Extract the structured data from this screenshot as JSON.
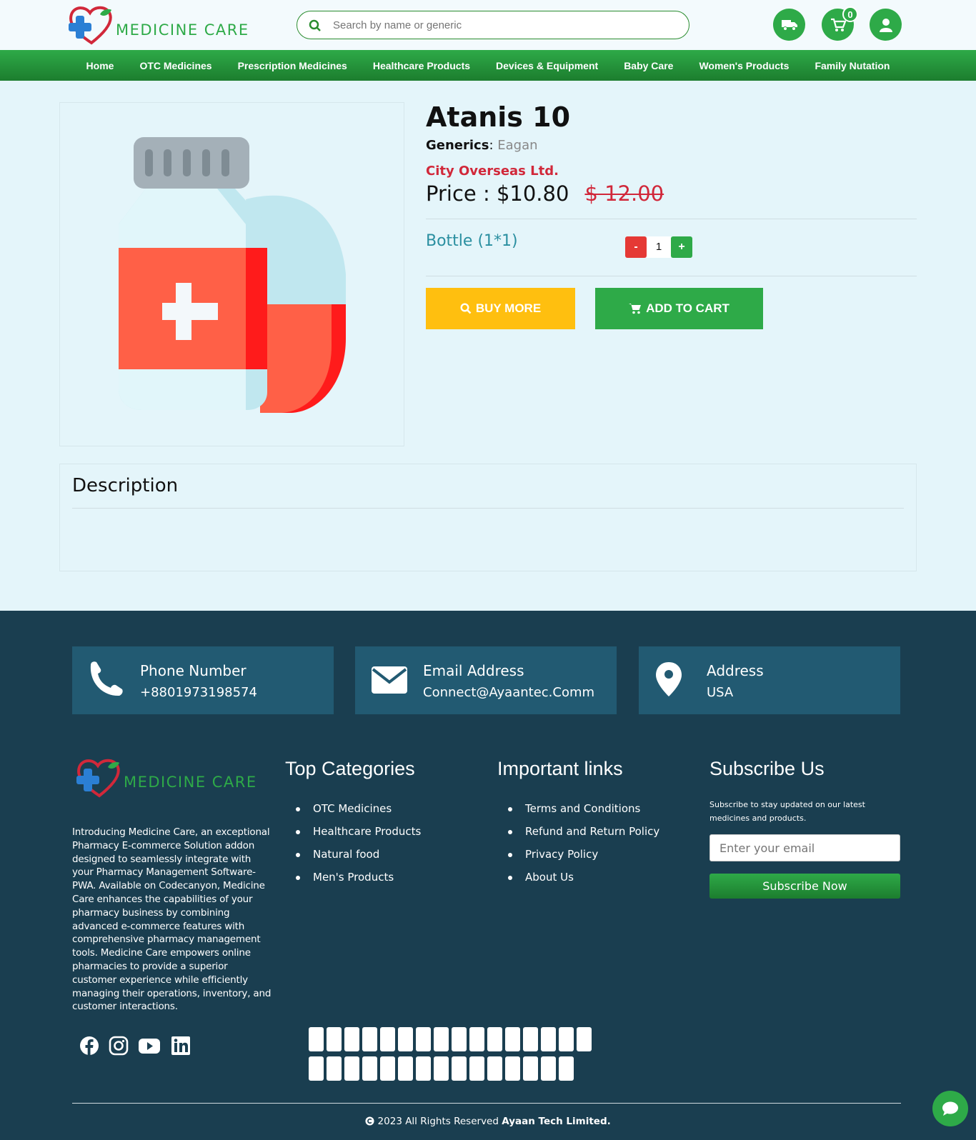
{
  "brand": {
    "name": "MEDICINE CARE",
    "accent": "#2eaa48",
    "danger": "#d1283a"
  },
  "search": {
    "placeholder": "Search by name or generic"
  },
  "header": {
    "cart_count": "0",
    "icons": [
      "delivery-truck-icon",
      "cart-icon",
      "user-icon"
    ]
  },
  "nav": {
    "items": [
      {
        "label": "Home"
      },
      {
        "label": "OTC Medicines"
      },
      {
        "label": "Prescription Medicines"
      },
      {
        "label": "Healthcare Products"
      },
      {
        "label": "Devices & Equipment"
      },
      {
        "label": "Baby Care"
      },
      {
        "label": "Women's Products"
      },
      {
        "label": "Family Nutation"
      }
    ]
  },
  "product": {
    "title": "Atanis 10",
    "generics_label": "Generics",
    "generics_value": "Eagan",
    "manufacturer": "City Overseas Ltd.",
    "price_label": "Price : $10.80",
    "old_price": "$ 12.00",
    "unit": "Bottle (1*1)",
    "qty_minus": "-",
    "qty": "1",
    "qty_plus": "+",
    "buy_more": "BUY MORE",
    "add_to_cart": "ADD TO CART"
  },
  "description": {
    "heading": "Description"
  },
  "contact": {
    "phone_label": "Phone Number",
    "phone_value": "+8801973198574",
    "email_label": "Email Address",
    "email_value": "Connect@Ayaantec.Comm",
    "address_label": "Address",
    "address_value": "USA"
  },
  "footer": {
    "about": "Introducing Medicine Care, an exceptional Pharmacy E-commerce Solution addon designed to seamlessly integrate with your Pharmacy Management Software-PWA. Available on Codecanyon, Medicine Care enhances the capabilities of your pharmacy business by combining advanced e-commerce features with comprehensive pharmacy management tools. Medicine Care empowers online pharmacies to provide a superior customer experience while efficiently managing their operations, inventory, and customer interactions.",
    "top_categories_title": "Top Categories",
    "top_categories": [
      "OTC Medicines",
      "Healthcare Products",
      "Natural food",
      "Men's Products"
    ],
    "links_title": "Important links",
    "links": [
      "Terms and Conditions",
      "Refund and Return Policy",
      "Privacy Policy",
      "About Us"
    ],
    "subscribe_title": "Subscribe Us",
    "subscribe_text": "Subscribe to stay updated on our latest medicines and products.",
    "email_placeholder": "Enter your email",
    "subscribe_button": "Subscribe Now",
    "social": [
      "facebook-icon",
      "instagram-icon",
      "youtube-icon",
      "linkedin-icon"
    ],
    "copyright_prefix": "2023 All Rights Reserved",
    "copyright_company": "Ayaan Tech Limited."
  }
}
